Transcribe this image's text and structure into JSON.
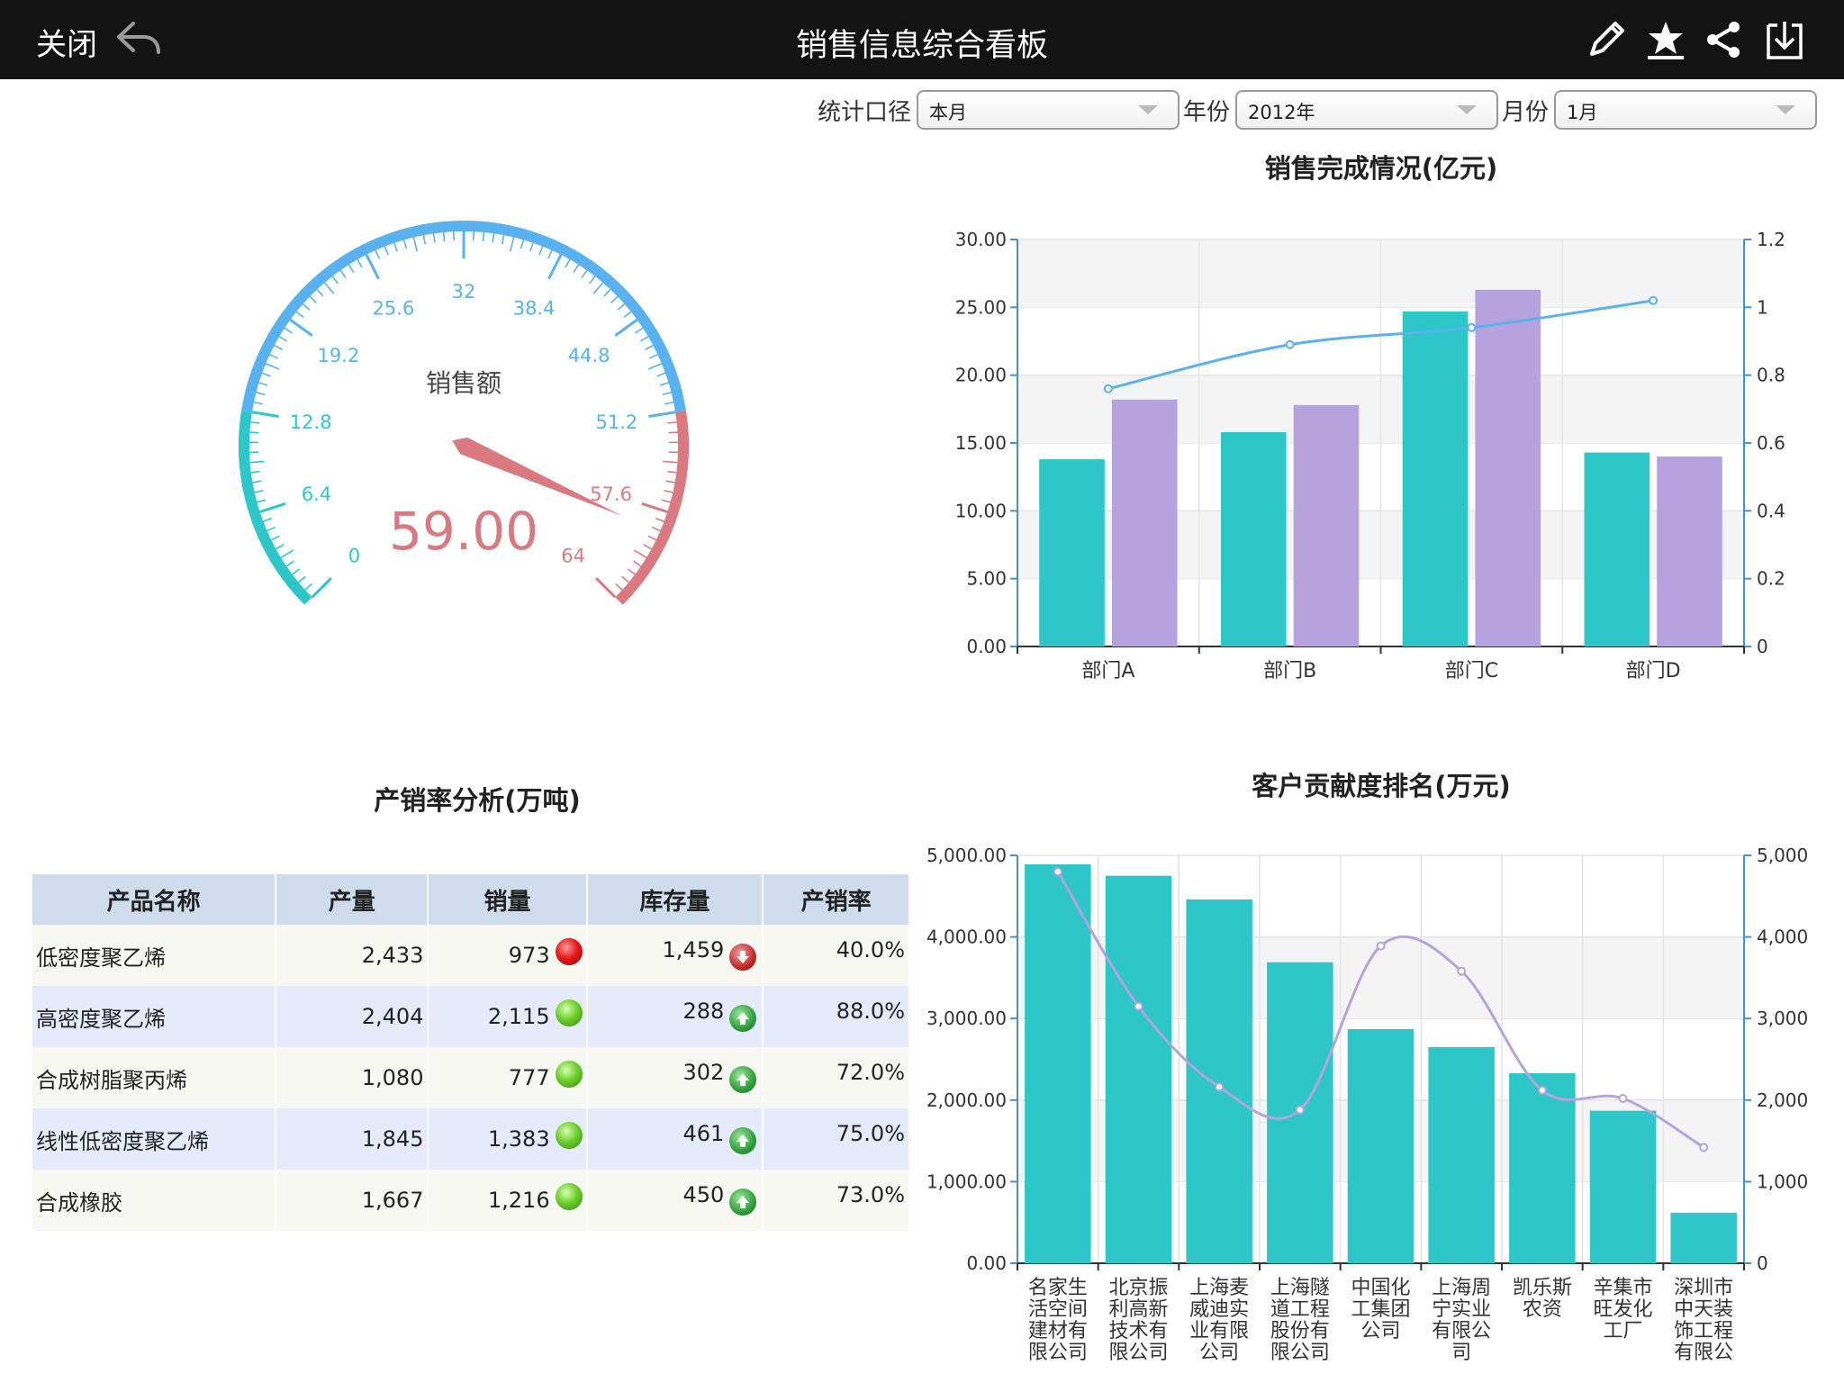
{
  "header": {
    "close_label": "关闭",
    "title": "销售信息综合看板",
    "icons": [
      "back-icon",
      "edit-icon",
      "favorite-icon",
      "share-icon",
      "download-icon"
    ]
  },
  "filters": {
    "stat_label": "统计口径",
    "stat_value": "本月",
    "year_label": "年份",
    "year_value": "2012年",
    "month_label": "月份",
    "month_value": "1月"
  },
  "gauge": {
    "title": "销售额",
    "value_text": "59.00",
    "value": 59,
    "min": 0,
    "max": 64,
    "tick_labels": [
      "0",
      "6.4",
      "12.8",
      "19.2",
      "25.6",
      "32",
      "38.4",
      "44.8",
      "51.2",
      "57.6",
      "64"
    ],
    "colors": {
      "low": "#2ec7c9",
      "mid": "#5ab1ef",
      "high": "#d87a80"
    }
  },
  "table": {
    "title": "产销率分析(万吨)",
    "headers": [
      "产品名称",
      "产量",
      "销量",
      "库存量",
      "产销率"
    ],
    "rows": [
      {
        "name": "低密度聚乙烯",
        "production": "2,433",
        "sales": "973",
        "sales_status": "red",
        "inventory": "1,459",
        "inv_trend": "down",
        "rate": "40.0%"
      },
      {
        "name": "高密度聚乙烯",
        "production": "2,404",
        "sales": "2,115",
        "sales_status": "green",
        "inventory": "288",
        "inv_trend": "up",
        "rate": "88.0%"
      },
      {
        "name": "合成树脂聚丙烯",
        "production": "1,080",
        "sales": "777",
        "sales_status": "green",
        "inventory": "302",
        "inv_trend": "up",
        "rate": "72.0%"
      },
      {
        "name": "线性低密度聚乙烯",
        "production": "1,845",
        "sales": "1,383",
        "sales_status": "green",
        "inventory": "461",
        "inv_trend": "up",
        "rate": "75.0%"
      },
      {
        "name": "合成橡胶",
        "production": "1,667",
        "sales": "1,216",
        "sales_status": "green",
        "inventory": "450",
        "inv_trend": "up",
        "rate": "73.0%"
      }
    ]
  },
  "chart_data": [
    {
      "type": "bar",
      "title": "销售完成情况(亿元)",
      "categories": [
        "部门A",
        "部门B",
        "部门C",
        "部门D"
      ],
      "series": [
        {
          "type": "bar",
          "values": [
            13.8,
            15.8,
            24.7,
            14.3
          ],
          "color": "#2ec7c9"
        },
        {
          "type": "bar",
          "values": [
            18.2,
            17.8,
            26.3,
            14.0
          ],
          "color": "#b6a2de"
        },
        {
          "type": "line",
          "axis": "right",
          "values": [
            0.76,
            0.89,
            0.94,
            1.02
          ],
          "color": "#5ab1ef"
        }
      ],
      "yleft": {
        "min": 0,
        "max": 30,
        "ticks": [
          "0.00",
          "5.00",
          "10.00",
          "15.00",
          "20.00",
          "25.00",
          "30.00"
        ]
      },
      "yright": {
        "min": 0,
        "max": 1.2,
        "ticks": [
          "0",
          "0.2",
          "0.4",
          "0.6",
          "0.8",
          "1",
          "1.2"
        ]
      },
      "grid": "banded"
    },
    {
      "type": "bar",
      "title": "客户贡献度排名(万元)",
      "categories": [
        [
          "名家生",
          "活空间",
          "建材有",
          "限公司"
        ],
        [
          "北京振",
          "利高新",
          "技术有",
          "限公司"
        ],
        [
          "上海麦",
          "威迪实",
          "业有限",
          "公司"
        ],
        [
          "上海隧",
          "道工程",
          "股份有",
          "限公司"
        ],
        [
          "中国化",
          "工集团",
          "公司"
        ],
        [
          "上海周",
          "宁实业",
          "有限公",
          "司"
        ],
        [
          "凯乐斯",
          "农资"
        ],
        [
          "辛集市",
          "旺发化",
          "工厂"
        ],
        [
          "深圳市",
          "中天装",
          "饰工程",
          "有限公"
        ]
      ],
      "series": [
        {
          "type": "bar",
          "values": [
            4890,
            4750,
            4460,
            3690,
            2870,
            2650,
            2330,
            1870,
            620
          ],
          "color": "#2ec7c9"
        },
        {
          "type": "line",
          "axis": "right",
          "values": [
            4800,
            3150,
            2160,
            1880,
            3890,
            3580,
            2120,
            2020,
            1420
          ],
          "color": "#b6a2de"
        }
      ],
      "yleft": {
        "min": 0,
        "max": 5000,
        "ticks": [
          "0.00",
          "1,000.00",
          "2,000.00",
          "3,000.00",
          "4,000.00",
          "5,000.00"
        ]
      },
      "yright": {
        "min": 0,
        "max": 5000,
        "ticks": [
          "0",
          "1,000",
          "2,000",
          "3,000",
          "4,000",
          "5,000"
        ]
      },
      "grid": "banded"
    }
  ]
}
